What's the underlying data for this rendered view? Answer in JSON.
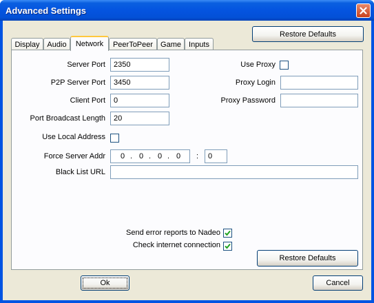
{
  "window": {
    "title": "Advanced Settings",
    "close_icon": "close-icon"
  },
  "top_restore_label": "Restore Defaults",
  "tabs": [
    {
      "label": "Display"
    },
    {
      "label": "Audio"
    },
    {
      "label": "Network"
    },
    {
      "label": "PeerToPeer"
    },
    {
      "label": "Game"
    },
    {
      "label": "Inputs"
    }
  ],
  "active_tab": "Network",
  "network": {
    "server_port": {
      "label": "Server Port",
      "value": "2350"
    },
    "p2p_server_port": {
      "label": "P2P Server Port",
      "value": "3450"
    },
    "client_port": {
      "label": "Client Port",
      "value": "0"
    },
    "port_broadcast_length": {
      "label": "Port Broadcast Length",
      "value": "20"
    },
    "use_local_address": {
      "label": "Use Local Address",
      "checked": false
    },
    "force_server_addr": {
      "label": "Force Server Addr",
      "ip": [
        "0",
        "0",
        "0",
        "0"
      ],
      "dot": ".",
      "port_sep": ":",
      "port": "0"
    },
    "black_list_url": {
      "label": "Black List URL",
      "value": ""
    },
    "use_proxy": {
      "label": "Use Proxy",
      "checked": false
    },
    "proxy_login": {
      "label": "Proxy Login",
      "value": ""
    },
    "proxy_password": {
      "label": "Proxy Password",
      "value": ""
    },
    "send_error_reports": {
      "label": "Send error reports to Nadeo",
      "checked": true
    },
    "check_internet": {
      "label": "Check internet connection",
      "checked": true
    },
    "restore_label": "Restore Defaults"
  },
  "footer": {
    "ok_label": "Ok",
    "cancel_label": "Cancel"
  }
}
